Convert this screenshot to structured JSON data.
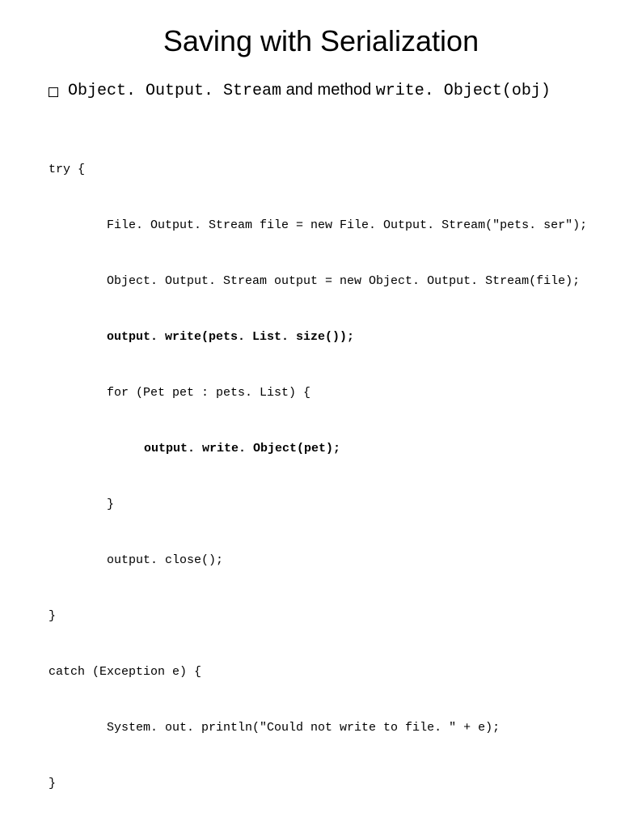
{
  "title": "Saving with Serialization",
  "bullet": {
    "code1": "Object. Output. Stream",
    "text": " and method ",
    "code2": "write. Object(obj)"
  },
  "code": {
    "l1": "try {",
    "l2": "File. Output. Stream file = new File. Output. Stream(\"pets. ser\");",
    "l3": "Object. Output. Stream output = new Object. Output. Stream(file);",
    "l4": "output. write(pets. List. size());",
    "l5": "for (Pet pet : pets. List) {",
    "l6": "output. write. Object(pet);",
    "l7": "}",
    "l8": "output. close();",
    "l9": "}",
    "l10": "catch (Exception e) {",
    "l11": "System. out. println(\"Could not write to file. \" + e);",
    "l12": "}"
  }
}
